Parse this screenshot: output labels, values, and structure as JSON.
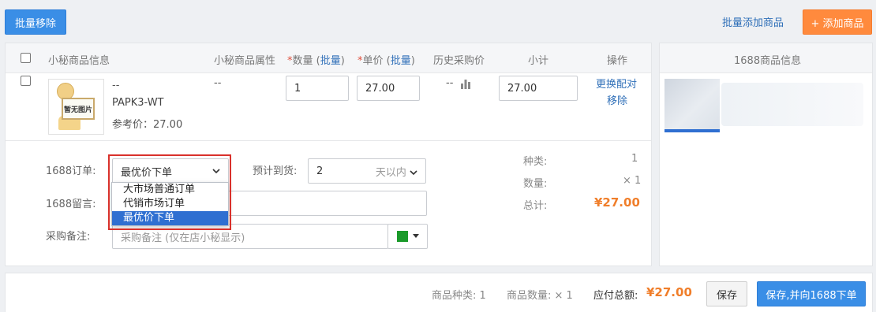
{
  "toolbar": {
    "batch_remove": "批量移除",
    "batch_add": "批量添加商品",
    "add_product": "+ 添加商品"
  },
  "table": {
    "headers": {
      "product_info": "小秘商品信息",
      "attributes": "小秘商品属性",
      "qty_star": "*",
      "qty": "数量",
      "qty_batch_open": "(",
      "qty_batch": "批量",
      "qty_batch_close": ")",
      "price_star": "*",
      "price": "单价",
      "price_batch_open": "(",
      "price_batch": "批量",
      "price_batch_close": ")",
      "history": "历史采购价",
      "subtotal": "小计",
      "actions": "操作"
    },
    "row": {
      "image_placeholder": "暂无图片",
      "name": "--",
      "sku": "PAPK3-WT",
      "ref_price": "参考价：27.00",
      "attribute": "--",
      "quantity": "1",
      "unit_price": "27.00",
      "history": "--",
      "subtotal": "27.00",
      "action_replace": "更换配对",
      "action_remove": "移除"
    }
  },
  "right_panel": {
    "header": "1688商品信息"
  },
  "order_form": {
    "order_label": "1688订单:",
    "order_type_selected": "最优价下单",
    "order_type_options": [
      "大市场普通订单",
      "代销市场订单",
      "最优价下单"
    ],
    "delivery_label": "预计到货:",
    "delivery_value": "2",
    "delivery_unit": "天以内",
    "message_label": "1688留言:",
    "note_label": "采购备注:",
    "note_placeholder": "采购备注 (仅在店小秘显示)",
    "note_color": "#1a9a2a"
  },
  "summary": {
    "kinds_label": "种类:",
    "kinds_value": "1",
    "count_label": "数量:",
    "count_value": "× 1",
    "total_label": "总计:",
    "total_value": "¥27.00"
  },
  "footer": {
    "kinds": "商品种类: 1",
    "count": "商品数量: × 1",
    "payable_label": "应付总额:",
    "payable_value": "¥27.00",
    "save": "保存",
    "save_order": "保存,并向1688下单"
  },
  "colors": {
    "primary": "#3a8ee6",
    "accent_orange": "#ff8a3d",
    "price_orange": "#f07e2a",
    "highlight_red": "#d9312b"
  }
}
